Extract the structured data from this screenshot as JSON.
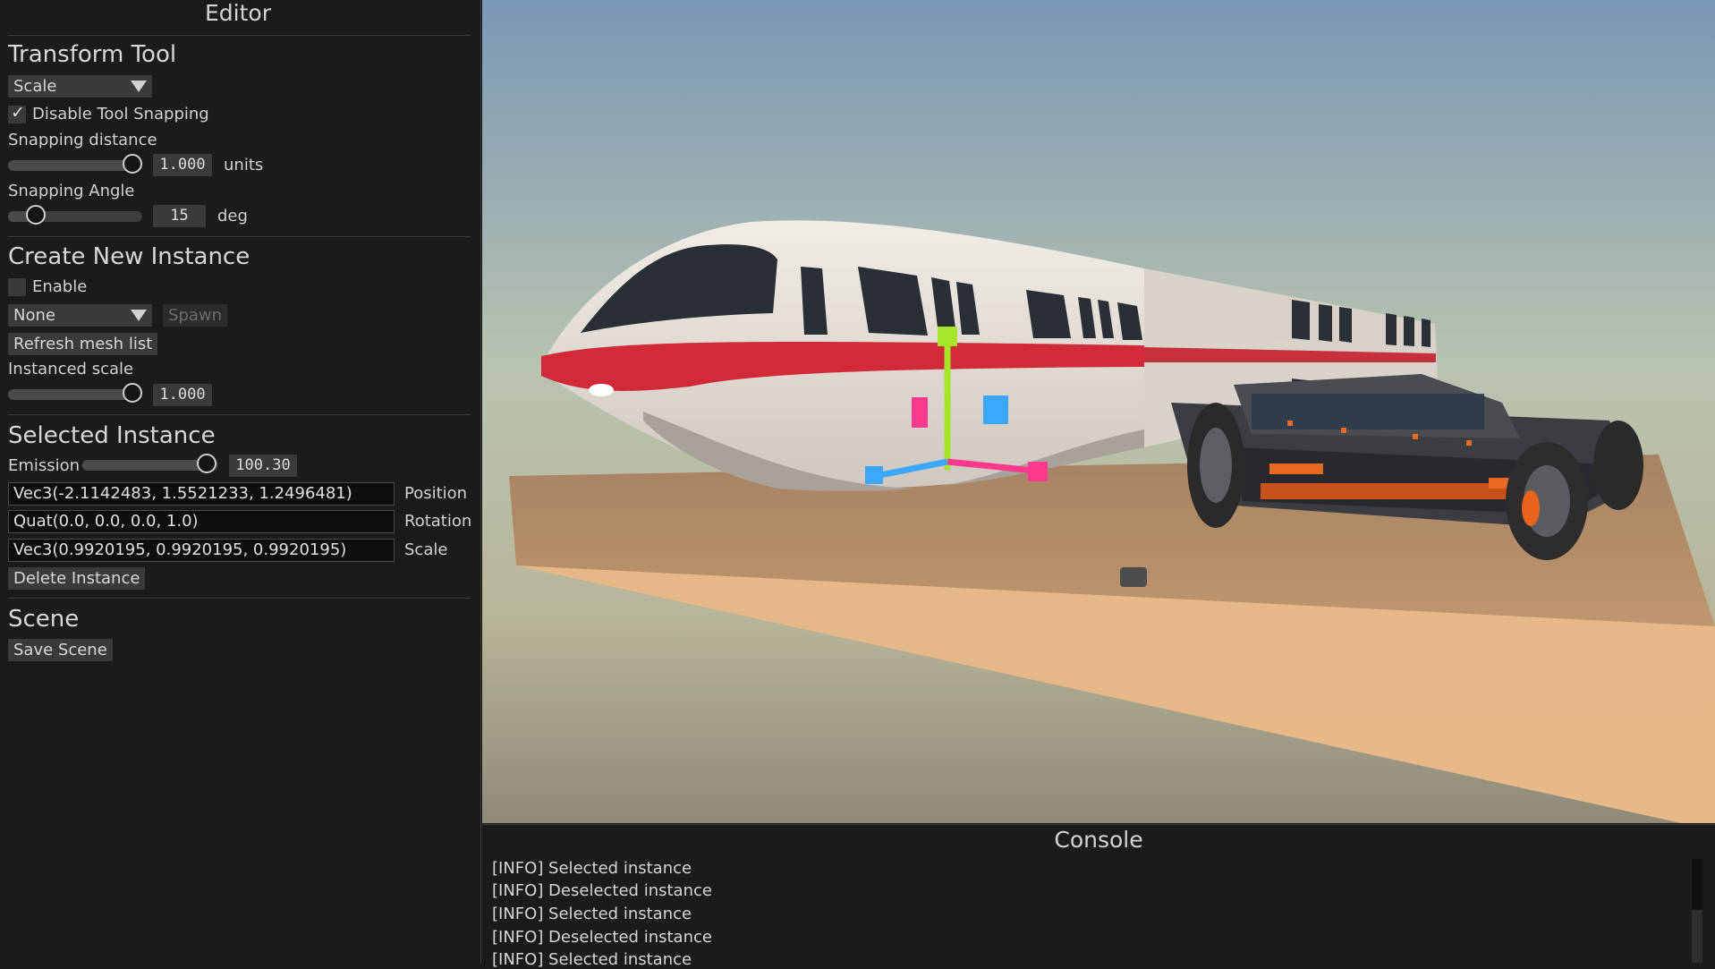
{
  "editor": {
    "title": "Editor",
    "transform_tool": {
      "heading": "Transform Tool",
      "mode": "Scale",
      "disable_snapping_label": "Disable Tool Snapping",
      "disable_snapping_checked": true,
      "snapping_distance_label": "Snapping distance",
      "snapping_distance_value": "1.000",
      "snapping_distance_unit": "units",
      "snapping_distance_fraction": 0.93,
      "snapping_angle_label": "Snapping Angle",
      "snapping_angle_value": "15",
      "snapping_angle_unit": "deg",
      "snapping_angle_fraction": 0.21
    },
    "create_instance": {
      "heading": "Create New Instance",
      "enable_label": "Enable",
      "enable_checked": false,
      "mesh_selected": "None",
      "spawn_label": "Spawn",
      "refresh_label": "Refresh mesh list",
      "instanced_scale_label": "Instanced scale",
      "instanced_scale_value": "1.000",
      "instanced_scale_fraction": 0.93
    },
    "selected_instance": {
      "heading": "Selected Instance",
      "emission_label": "Emission",
      "emission_value": "100.30",
      "emission_fraction": 0.95,
      "position_value": "Vec3(-2.1142483, 1.5521233, 1.2496481)",
      "position_label": "Position",
      "rotation_value": "Quat(0.0, 0.0, 0.0, 1.0)",
      "rotation_label": "Rotation",
      "scale_value": "Vec3(0.9920195, 0.9920195, 0.9920195)",
      "scale_label": "Scale",
      "delete_label": "Delete Instance"
    },
    "scene": {
      "heading": "Scene",
      "save_label": "Save Scene"
    }
  },
  "console": {
    "title": "Console",
    "lines": [
      "[INFO] Selected instance",
      "[INFO] Deselected instance",
      "[INFO] Selected instance",
      "[INFO] Deselected instance",
      "[INFO] Selected instance"
    ]
  },
  "colors": {
    "panel_bg": "#1b1b1b",
    "widget_bg": "#3a3a3a",
    "gizmo_y": "#9fe22a",
    "gizmo_x": "#ff3a8c",
    "gizmo_z": "#3aa8ff",
    "platform": "#e4b282",
    "sky_top": "#7b98b4",
    "sky_horizon": "#c7c69e"
  }
}
